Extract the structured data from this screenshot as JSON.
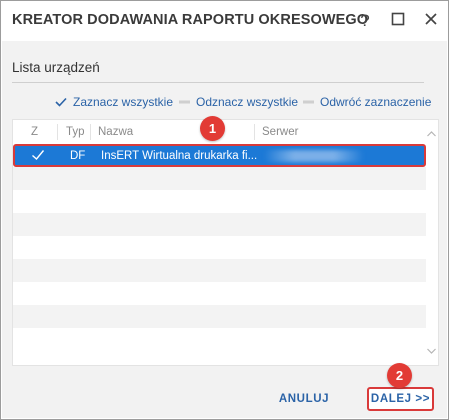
{
  "window": {
    "title": "KREATOR DODAWANIA RAPORTU OKRESOWEGO",
    "help_label": "?"
  },
  "section": {
    "title": "Lista urządzeń"
  },
  "actions": {
    "select_all": "Zaznacz wszystkie",
    "deselect_all": "Odznacz wszystkie",
    "invert": "Odwróć zaznaczenie"
  },
  "grid": {
    "columns": {
      "z": "Z",
      "typ": "Typ",
      "nazwa": "Nazwa",
      "serwer": "Serwer"
    },
    "rows": [
      {
        "selected": true,
        "checked": true,
        "typ": "DF",
        "nazwa": "InsERT Wirtualna drukarka fi...",
        "serwer": ""
      }
    ],
    "empty_rows": 9
  },
  "badges": {
    "one": "1",
    "two": "2"
  },
  "footer": {
    "cancel_label": "ANULUJ",
    "next_label": "DALEJ >>"
  },
  "colors": {
    "accent": "#2b63a7",
    "selection": "#1c79d6",
    "highlight": "#d93a3a",
    "badge": "#e23b35"
  }
}
